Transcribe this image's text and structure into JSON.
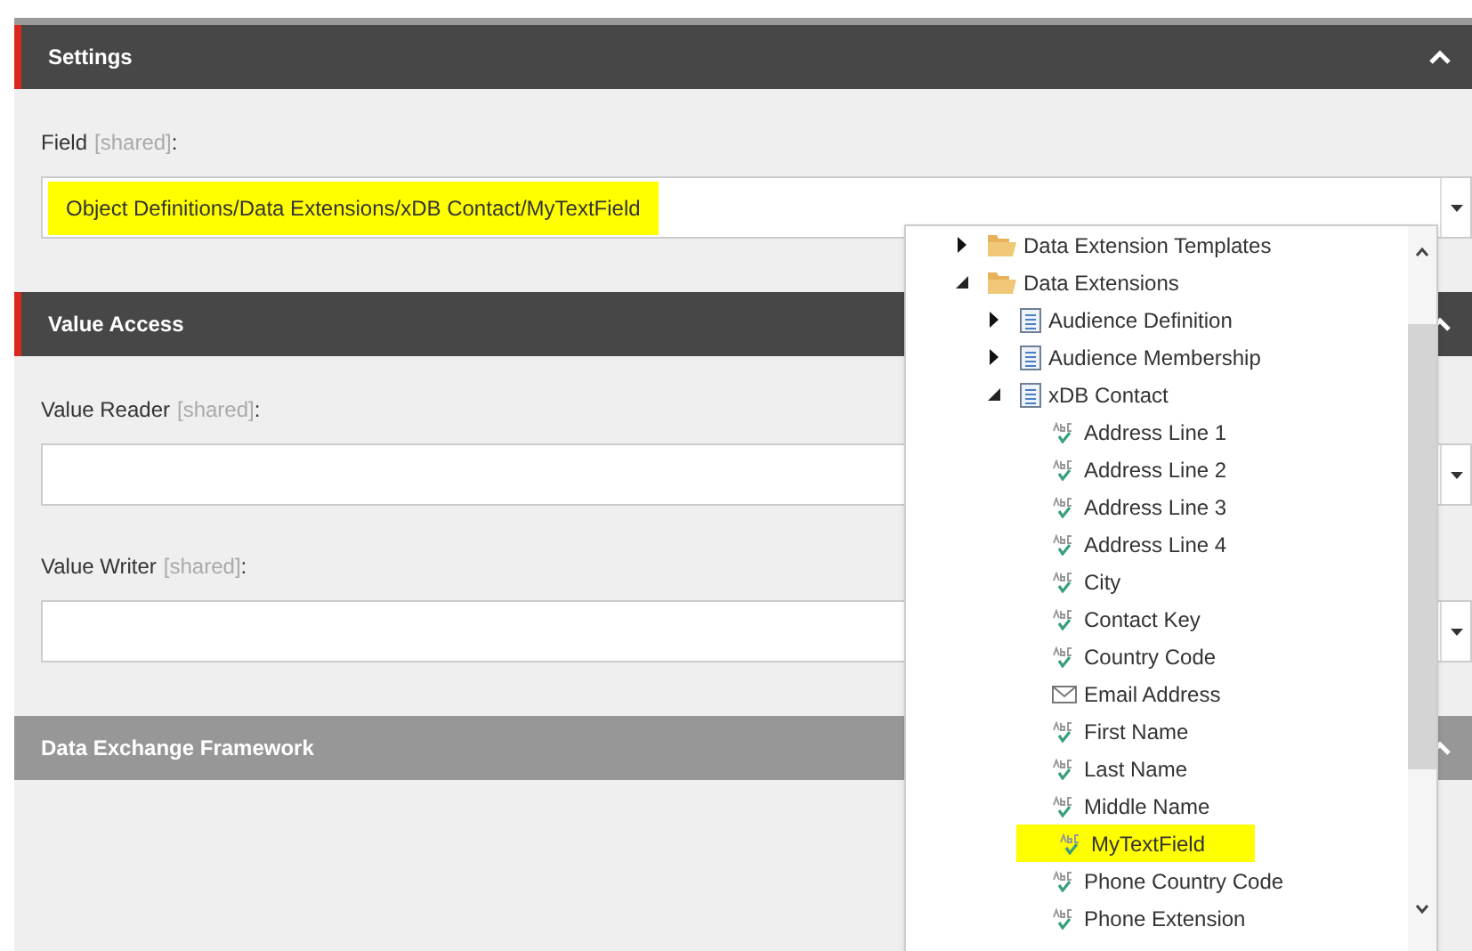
{
  "sections": [
    {
      "title": "Settings",
      "highlighted": true,
      "expanded": true,
      "fields": [
        {
          "label": "Field",
          "tag": "[shared]",
          "suffix": ":",
          "value": "Object Definitions/Data Extensions/xDB Contact/MyTextField"
        }
      ]
    },
    {
      "title": "Value Access",
      "highlighted": true,
      "expanded": true,
      "fields": [
        {
          "label": "Value Reader",
          "tag": "[shared]",
          "suffix": ":"
        },
        {
          "label": "Value Writer",
          "tag": "[shared]",
          "suffix": ":"
        }
      ]
    },
    {
      "title": "Data Exchange Framework",
      "highlighted": false,
      "expanded": true
    }
  ],
  "dropdown_tree": [
    {
      "label": "Data Extension Templates",
      "kind": "folder",
      "expanded": false,
      "selected": false
    },
    {
      "label": "Data Extensions",
      "kind": "folder",
      "expanded": true,
      "selected": false,
      "children": [
        {
          "label": "Audience Definition",
          "kind": "entity",
          "expanded": false,
          "selected": false
        },
        {
          "label": "Audience Membership",
          "kind": "entity",
          "expanded": false,
          "selected": false
        },
        {
          "label": "xDB Contact",
          "kind": "entity",
          "expanded": true,
          "selected": false,
          "children": [
            {
              "label": "Address Line 1",
              "kind": "text",
              "selected": false
            },
            {
              "label": "Address Line 2",
              "kind": "text",
              "selected": false
            },
            {
              "label": "Address Line 3",
              "kind": "text",
              "selected": false
            },
            {
              "label": "Address Line 4",
              "kind": "text",
              "selected": false
            },
            {
              "label": "City",
              "kind": "text",
              "selected": false
            },
            {
              "label": "Contact Key",
              "kind": "text",
              "selected": false
            },
            {
              "label": "Country Code",
              "kind": "text",
              "selected": false
            },
            {
              "label": "Email Address",
              "kind": "email",
              "selected": false
            },
            {
              "label": "First Name",
              "kind": "text",
              "selected": false
            },
            {
              "label": "Last Name",
              "kind": "text",
              "selected": false
            },
            {
              "label": "Middle Name",
              "kind": "text",
              "selected": false
            },
            {
              "label": "MyTextField",
              "kind": "text",
              "selected": true
            },
            {
              "label": "Phone Country Code",
              "kind": "text",
              "selected": false
            },
            {
              "label": "Phone Extension",
              "kind": "text",
              "selected": false
            }
          ]
        }
      ]
    }
  ]
}
